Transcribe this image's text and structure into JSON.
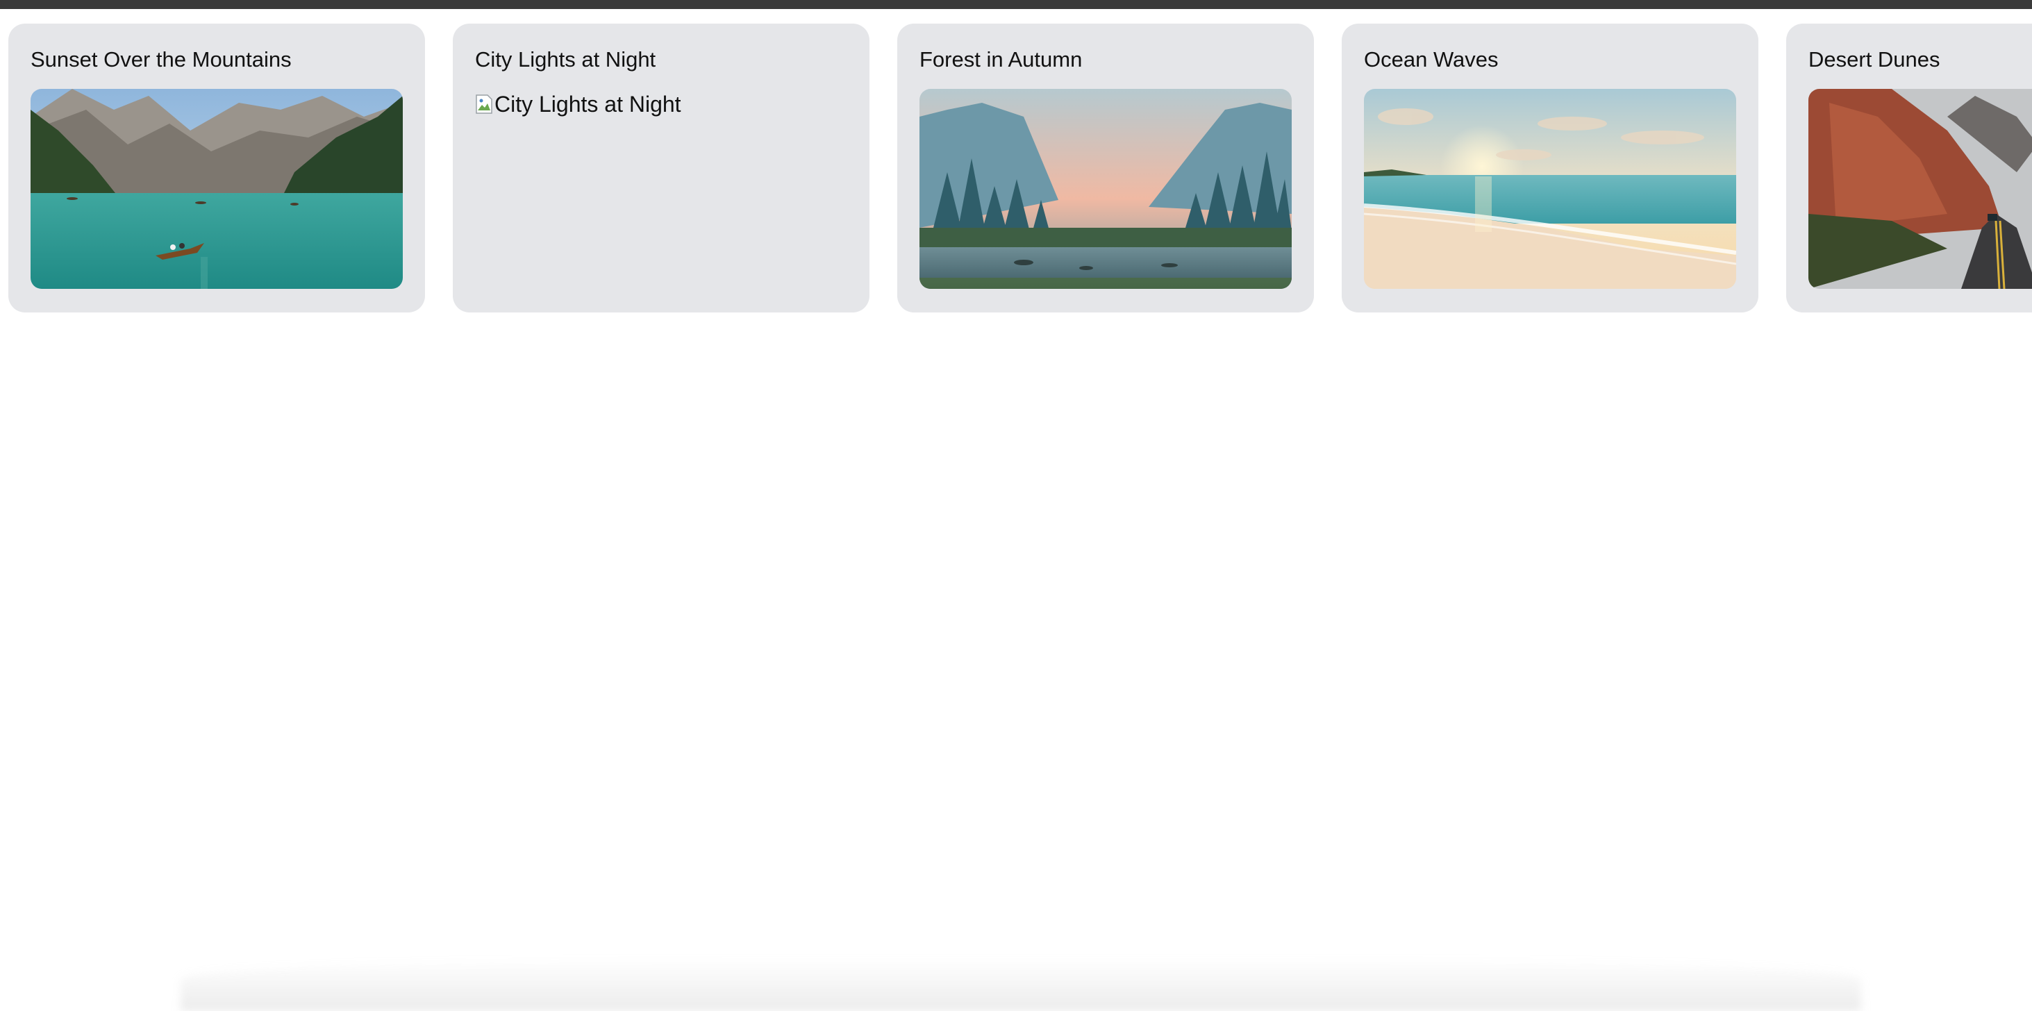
{
  "cards": [
    {
      "title": "Sunset Over the Mountains",
      "image_alt": "Sunset Over the Mountains",
      "image_loaded": true
    },
    {
      "title": "City Lights at Night",
      "image_alt": "City Lights at Night",
      "image_loaded": false
    },
    {
      "title": "Forest in Autumn",
      "image_alt": "Forest in Autumn",
      "image_loaded": true
    },
    {
      "title": "Ocean Waves",
      "image_alt": "Ocean Waves",
      "image_loaded": true
    },
    {
      "title": "Desert Dunes",
      "image_alt": "Desert Dunes",
      "image_loaded": true
    }
  ],
  "colors": {
    "card_background": "#e5e6e9",
    "top_bar": "#3a3a3a",
    "page_background": "#ffffff"
  },
  "icons": {
    "broken_image": "broken-image-icon"
  }
}
